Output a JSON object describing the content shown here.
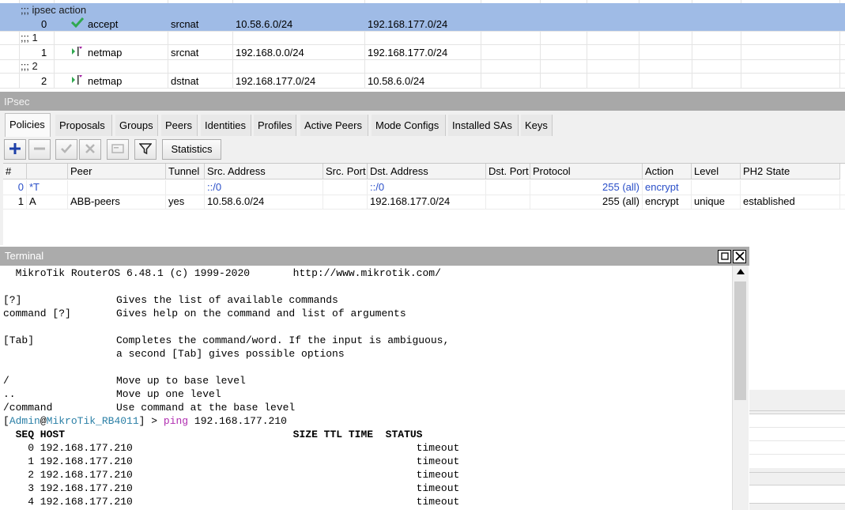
{
  "nat": {
    "rows": [
      {
        "type": "comment",
        "text": ";;; ipsec action",
        "selected": true
      },
      {
        "type": "rule",
        "num": "0",
        "action": "accept",
        "icon": "check-icon",
        "chain": "srcnat",
        "src": "10.58.6.0/24",
        "dst": "192.168.177.0/24",
        "selected": true
      },
      {
        "type": "comment",
        "text": ";;; 1"
      },
      {
        "type": "rule",
        "num": "1",
        "action": "netmap",
        "icon": "netmap-icon",
        "chain": "srcnat",
        "src": "192.168.0.0/24",
        "dst": "192.168.177.0/24"
      },
      {
        "type": "comment",
        "text": ";;; 2"
      },
      {
        "type": "rule",
        "num": "2",
        "action": "netmap",
        "icon": "netmap-icon",
        "chain": "dstnat",
        "src": "192.168.177.0/24",
        "dst": "10.58.6.0/24"
      }
    ]
  },
  "ipsec": {
    "title": "IPsec",
    "tabs": [
      "Policies",
      "Proposals",
      "Groups",
      "Peers",
      "Identities",
      "Profiles",
      "Active Peers",
      "Mode Configs",
      "Installed SAs",
      "Keys"
    ],
    "active_tab": "Policies",
    "toolbar": {
      "add_icon": "plus-icon",
      "remove_icon": "minus-icon",
      "enable_icon": "check-icon",
      "disable_icon": "cross-icon",
      "comment_icon": "note-icon",
      "filter_icon": "filter-icon",
      "statistics_label": "Statistics"
    },
    "columns": [
      "#",
      "Peer",
      "Tunnel",
      "Src. Address",
      "Src. Port",
      "Dst. Address",
      "Dst. Port",
      "Protocol",
      "Action",
      "Level",
      "PH2 State"
    ],
    "rows": [
      {
        "num": "0",
        "flags": "*T",
        "peer": "",
        "tunnel": "",
        "src": "::/0",
        "src_port": "",
        "dst": "::/0",
        "dst_port": "",
        "protocol": "255 (all)",
        "action": "encrypt",
        "level": "",
        "ph2": "",
        "template": true
      },
      {
        "num": "1",
        "flags": "A",
        "peer": "ABB-peers",
        "tunnel": "yes",
        "src": "10.58.6.0/24",
        "src_port": "",
        "dst": "192.168.177.0/24",
        "dst_port": "",
        "protocol": "255 (all)",
        "action": "encrypt",
        "level": "unique",
        "ph2": "established",
        "template": false
      }
    ]
  },
  "terminal": {
    "title": "Terminal",
    "restore_icon": "restore-icon",
    "close_icon": "close-icon",
    "header": "  MikroTik RouterOS 6.48.1 (c) 1999-2020       http://www.mikrotik.com/",
    "help": [
      {
        "key": "[?]",
        "desc": "Gives the list of available commands"
      },
      {
        "key": "command [?]",
        "desc": "Gives help on the command and list of arguments"
      },
      {
        "key": "[Tab]",
        "desc": "Completes the command/word. If the input is ambiguous,"
      },
      {
        "key": "",
        "desc": "a second [Tab] gives possible options"
      },
      {
        "key": "/",
        "desc": "Move up to base level"
      },
      {
        "key": "..",
        "desc": "Move up one level"
      },
      {
        "key": "/command",
        "desc": "Use command at the base level"
      }
    ],
    "prompt": {
      "open": "[",
      "user": "Admin",
      "at": "@",
      "host": "MikroTik_RB4011",
      "close": "] > ",
      "command": "ping",
      "args": " 192.168.177.210"
    },
    "ping_header": "  SEQ HOST                                     SIZE TTL TIME  STATUS",
    "ping_rows": [
      "    0 192.168.177.210                                              timeout",
      "    1 192.168.177.210                                              timeout",
      "    2 192.168.177.210                                              timeout",
      "    3 192.168.177.210                                              timeout",
      "    4 192.168.177.210                                              timeout"
    ],
    "scroll_up_icon": "arrow-up-icon"
  }
}
